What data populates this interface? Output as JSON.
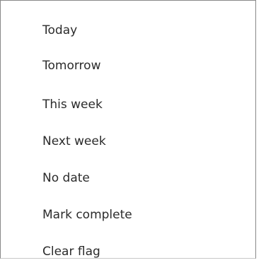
{
  "context_menu": {
    "items": [
      {
        "label": "Today"
      },
      {
        "label": "Tomorrow"
      },
      {
        "label": "This week"
      },
      {
        "label": "Next week"
      },
      {
        "label": "No date"
      },
      {
        "label": "Mark complete"
      },
      {
        "label": "Clear flag"
      }
    ]
  }
}
